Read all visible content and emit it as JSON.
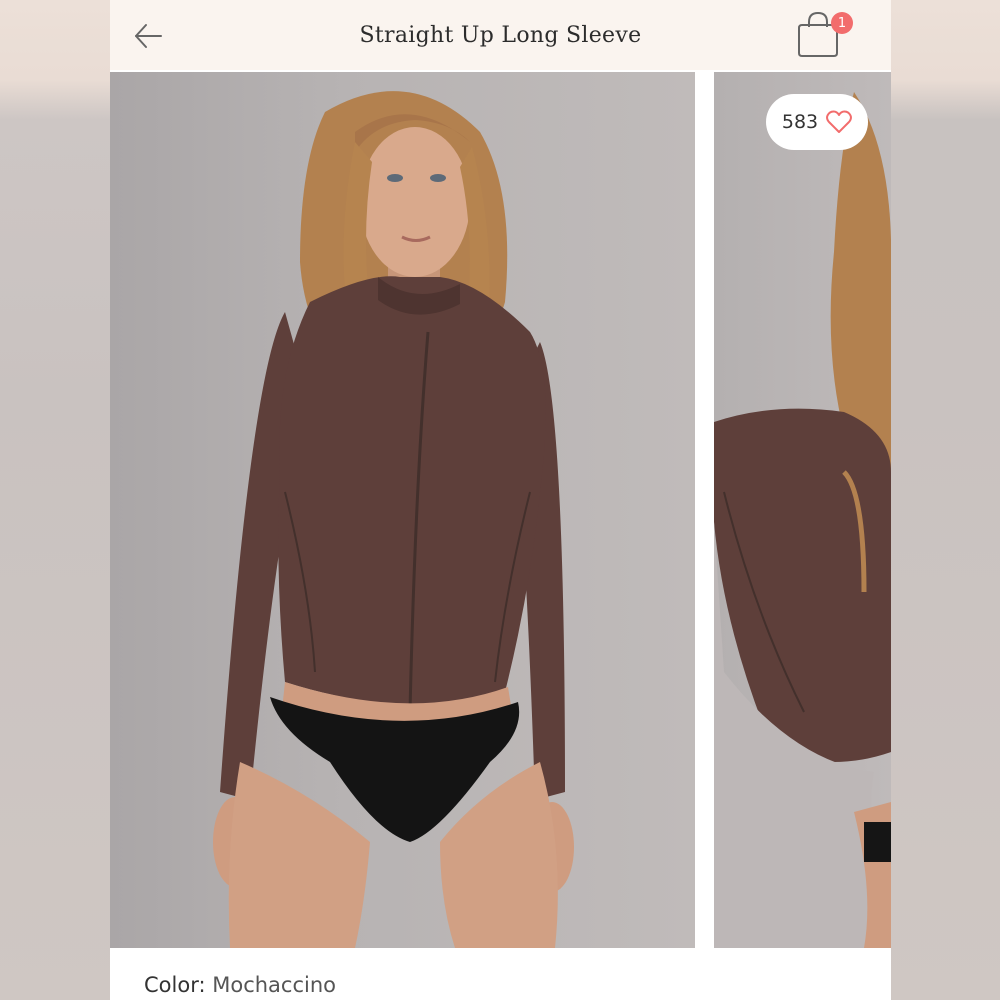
{
  "header": {
    "title": "Straight Up Long Sleeve",
    "back_icon": "arrow-left-icon",
    "bag_icon": "shopping-bag-icon",
    "bag_count": "1"
  },
  "gallery": {
    "like_count": "583",
    "like_icon": "heart-outline-icon"
  },
  "product": {
    "color_label": "Color:",
    "color_value": "Mochaccino"
  },
  "colors": {
    "header_bg": "#faf4ef",
    "badge": "#f26c6c",
    "heart": "#f26c6c",
    "garment": "#5e3f3a"
  }
}
